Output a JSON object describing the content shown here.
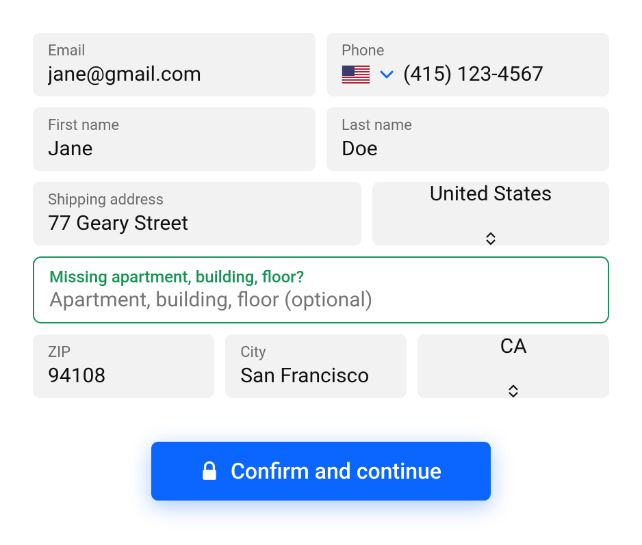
{
  "form": {
    "email": {
      "label": "Email",
      "value": "jane@gmail.com"
    },
    "phone": {
      "label": "Phone",
      "country_flag": "us",
      "value": "(415) 123-4567"
    },
    "first_name": {
      "label": "First name",
      "value": "Jane"
    },
    "last_name": {
      "label": "Last name",
      "value": "Doe"
    },
    "shipping_address": {
      "label": "Shipping address",
      "value": "77 Geary Street"
    },
    "country": {
      "selected": "United States"
    },
    "apartment": {
      "label": "Missing apartment, building, floor?",
      "placeholder": "Apartment, building, floor (optional)",
      "value": ""
    },
    "zip": {
      "label": "ZIP",
      "value": "94108"
    },
    "city": {
      "label": "City",
      "value": "San Francisco"
    },
    "state": {
      "selected": "CA"
    }
  },
  "actions": {
    "confirm_label": "Confirm and continue"
  },
  "colors": {
    "primary": "#0a66ff",
    "success": "#169454",
    "field_bg": "#f2f2f2"
  }
}
